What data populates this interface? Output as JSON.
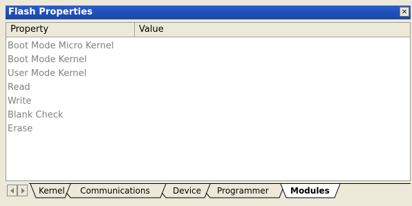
{
  "window": {
    "title": "Flash Properties",
    "close_glyph": "×"
  },
  "table": {
    "columns": [
      "Property",
      "Value"
    ],
    "rows": [
      "Boot Mode Micro Kernel",
      "Boot Mode Kernel",
      "User Mode Kernel",
      "Read",
      "Write",
      "Blank Check",
      "Erase"
    ],
    "row_text_color": "#808080"
  },
  "tabs": {
    "items": [
      "Kernel",
      "Communications",
      "Device",
      "Programmer",
      "Modules"
    ],
    "active": "Modules"
  },
  "icons": {
    "scroll_left": "triangle-left-icon",
    "scroll_right": "triangle-right-icon",
    "close": "close-icon"
  },
  "colors": {
    "titlebar": "#1f4fb8",
    "chrome": "#ece9d8"
  }
}
